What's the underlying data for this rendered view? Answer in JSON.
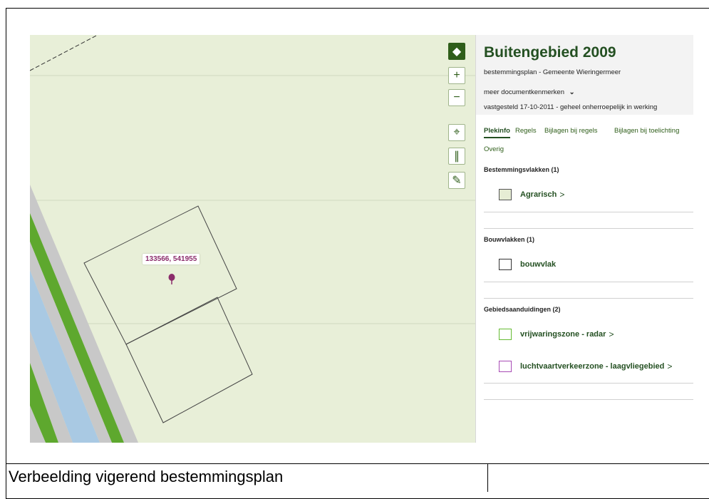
{
  "map": {
    "coordinate_label": "133566, 541955",
    "controls": [
      {
        "name": "layers-button",
        "icon": "layers-icon",
        "glyph": "◆"
      },
      {
        "name": "zoom-in-button",
        "icon": "plus-icon",
        "glyph": "+"
      },
      {
        "name": "zoom-out-button",
        "icon": "minus-icon",
        "glyph": "−"
      },
      {
        "name": "locate-button",
        "icon": "locate-icon",
        "glyph": "⌖"
      },
      {
        "name": "measure-button",
        "icon": "ruler-icon",
        "glyph": "∥"
      },
      {
        "name": "draw-button",
        "icon": "pencil-icon",
        "glyph": "✎"
      }
    ]
  },
  "panel": {
    "title": "Buitengebied 2009",
    "subtitle": "bestemmingsplan - Gemeente Wieringermeer",
    "meer_label": "meer documentkenmerken",
    "meer_icon": "⌄",
    "status": "vastgesteld 17-10-2011 - geheel onherroepelijk in werking",
    "tabs": [
      "Plekinfo",
      "Regels",
      "Bijlagen bij regels",
      "Bijlagen bij toelichting",
      "Overig"
    ],
    "sections": [
      {
        "title": "Bestemmingsvlakken (1)",
        "items": [
          {
            "label": "Agrarisch",
            "chevron": ">",
            "swatch_fill": "#e6edd4",
            "swatch_border": "#555555"
          }
        ]
      },
      {
        "title": "Bouwvlakken (1)",
        "items": [
          {
            "label": "bouwvlak",
            "chevron": "",
            "swatch_fill": "#ffffff",
            "swatch_border": "#333333"
          }
        ]
      },
      {
        "title": "Gebiedsaanduidingen (2)",
        "items": [
          {
            "label": "vrijwaringszone - radar",
            "chevron": ">",
            "swatch_fill": "#ffffff",
            "swatch_border": "#66bb33"
          },
          {
            "label": "luchtvaartverkeerzone - laagvliegebied",
            "chevron": ">",
            "swatch_fill": "#ffffff",
            "swatch_border": "#a84bb5"
          }
        ]
      }
    ]
  },
  "caption": "Verbeelding vigerend bestemmingsplan",
  "colors": {
    "map_background": "#e8efd8",
    "accent_green": "#245022",
    "marker": "#8b2c6b",
    "strip_green": "#5ea82e",
    "strip_blue": "#a9c9e3",
    "strip_grey": "#c8c8c8"
  }
}
